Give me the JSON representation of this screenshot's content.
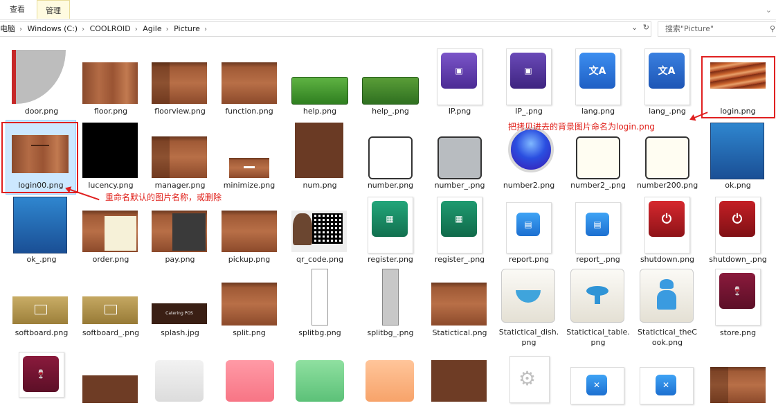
{
  "ribbon": {
    "tab_view": "查看",
    "tab_manage": "管理"
  },
  "address": {
    "parts": [
      "电脑",
      "Windows (C:)",
      "COOLROID",
      "Agile",
      "Picture"
    ]
  },
  "search": {
    "placeholder": "搜索\"Picture\""
  },
  "files": [
    {
      "name": "door.png"
    },
    {
      "name": "floor.png"
    },
    {
      "name": "floorview.png"
    },
    {
      "name": "function.png"
    },
    {
      "name": "help.png"
    },
    {
      "name": "help_.png"
    },
    {
      "name": "IP.png"
    },
    {
      "name": "IP_.png"
    },
    {
      "name": "lang.png"
    },
    {
      "name": "lang_.png"
    },
    {
      "name": "login.png"
    },
    {
      "name": "login00.png"
    },
    {
      "name": "lucency.png"
    },
    {
      "name": "manager.png"
    },
    {
      "name": "minimize.png"
    },
    {
      "name": "num.png"
    },
    {
      "name": "number.png"
    },
    {
      "name": "number_.png"
    },
    {
      "name": "number2.png"
    },
    {
      "name": "number2_.png"
    },
    {
      "name": "number200.png"
    },
    {
      "name": "ok.png"
    },
    {
      "name": "ok_.png"
    },
    {
      "name": "order.png"
    },
    {
      "name": "pay.png"
    },
    {
      "name": "pickup.png"
    },
    {
      "name": "qr_code.png"
    },
    {
      "name": "register.png"
    },
    {
      "name": "register_.png"
    },
    {
      "name": "report.png"
    },
    {
      "name": "report_.png"
    },
    {
      "name": "shutdown.png"
    },
    {
      "name": "shutdown_.png"
    },
    {
      "name": "softboard.png"
    },
    {
      "name": "softboard_.png"
    },
    {
      "name": "splash.jpg"
    },
    {
      "name": "split.png"
    },
    {
      "name": "splitbg.png"
    },
    {
      "name": "splitbg_.png"
    },
    {
      "name": "Statictical.png"
    },
    {
      "name": "Statictical_dish.png",
      "l1": "Statictical_dish.",
      "l2": "png"
    },
    {
      "name": "Statictical_table.png",
      "l1": "Statictical_table.",
      "l2": "png"
    },
    {
      "name": "Statictical_theCook.png",
      "l1": "Statictical_theC",
      "l2": "ook.png"
    },
    {
      "name": "store.png"
    }
  ],
  "thumb_text": {
    "splash": "Catering POS"
  },
  "annotations": {
    "top": "把拷贝进去的背景图片命名为login.png",
    "left": "重命名默认的图片名称，或删除"
  },
  "colors": {
    "annotation": "#e0201a",
    "selection": "#cce8ff"
  }
}
